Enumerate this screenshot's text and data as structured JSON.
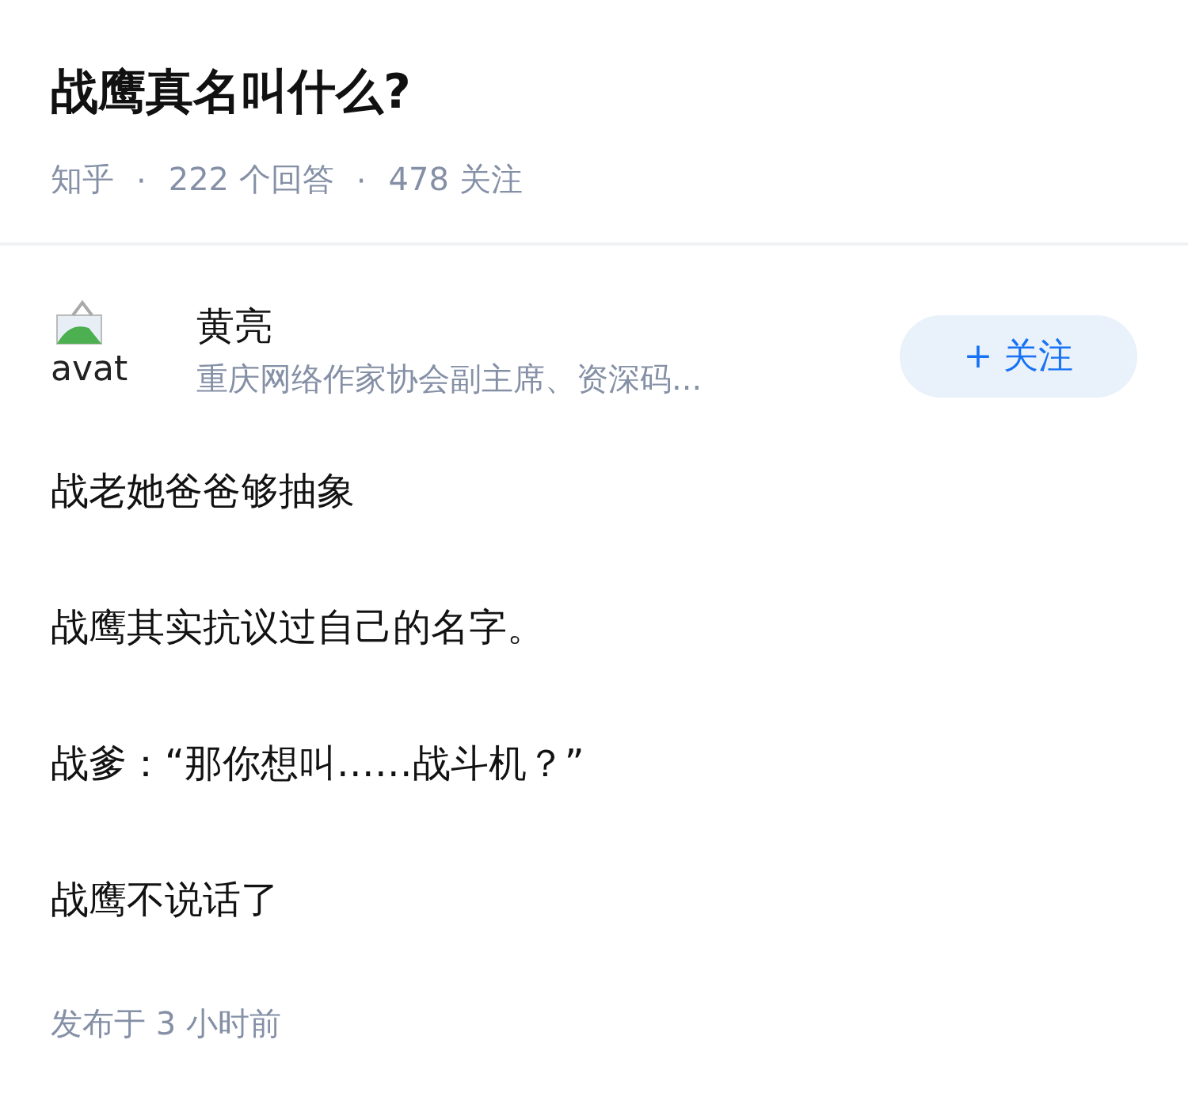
{
  "question": {
    "title": "战鹰真名叫什么?",
    "source": "知乎",
    "separator": "·",
    "answers": "222 个回答",
    "follows": "478 关注"
  },
  "author": {
    "avatar_alt": "avat",
    "name": "黄亮",
    "bio": "重庆网络作家协会副主席、资深码...",
    "follow_button": "+ 关注"
  },
  "paragraphs": [
    "战老她爸爸够抽象",
    "战鹰其实抗议过自己的名字。",
    "战爹：“那你想叫……战斗机？”",
    "战鹰不说话了"
  ],
  "published": "发布于  3 小时前"
}
